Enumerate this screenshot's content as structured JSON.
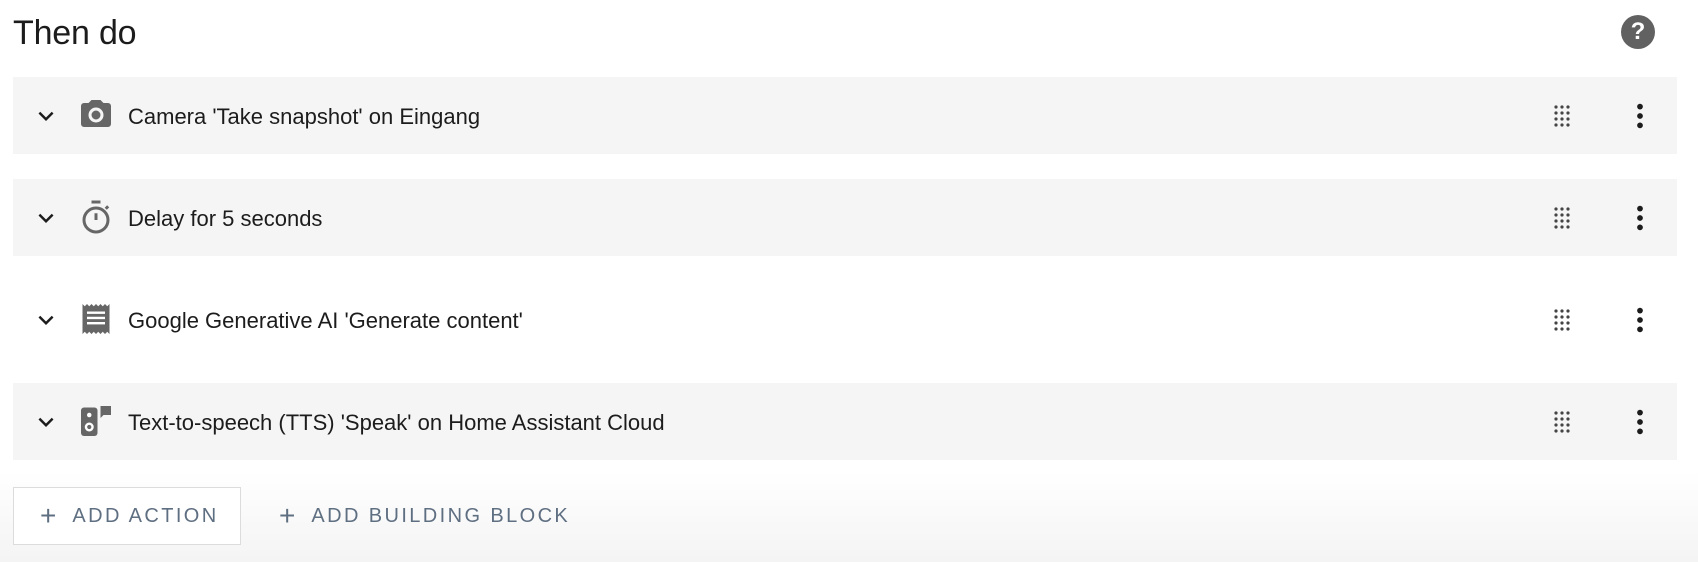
{
  "section": {
    "title": "Then do"
  },
  "help": {
    "icon": "help-circle-icon",
    "glyph": "?"
  },
  "actions": [
    {
      "label": "Camera 'Take snapshot' on Eingang",
      "icon": "camera-icon"
    },
    {
      "label": "Delay for 5 seconds",
      "icon": "timer-icon"
    },
    {
      "label": "Google Generative AI 'Generate content'",
      "icon": "receipt-icon"
    },
    {
      "label": "Text-to-speech (TTS) 'Speak' on Home Assistant Cloud",
      "icon": "speaker-message-icon"
    }
  ],
  "buttons": {
    "add_action": "ADD ACTION",
    "add_building_block": "ADD BUILDING BLOCK",
    "plus_glyph": "+"
  },
  "colors": {
    "icon": "#666666",
    "row_bg": "#f5f5f5",
    "button_text": "#5f6f82"
  }
}
